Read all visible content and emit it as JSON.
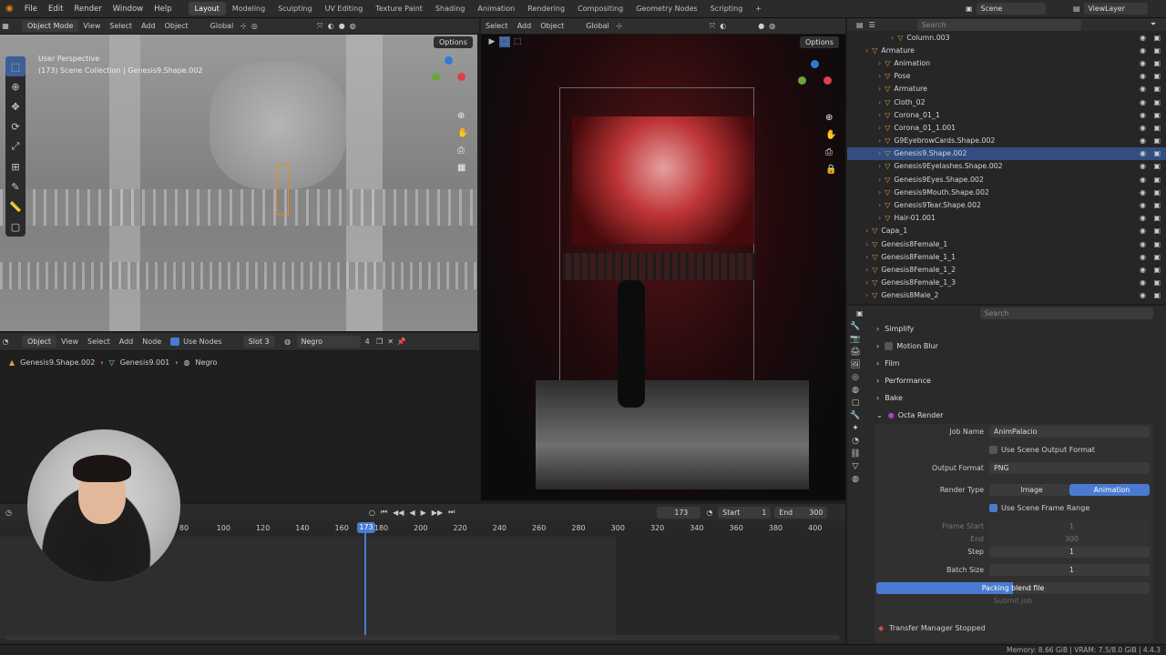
{
  "menu": [
    "File",
    "Edit",
    "Render",
    "Window",
    "Help"
  ],
  "workspaces": [
    "Layout",
    "Modeling",
    "Sculpting",
    "UV Editing",
    "Texture Paint",
    "Shading",
    "Animation",
    "Rendering",
    "Compositing",
    "Geometry Nodes",
    "Scripting"
  ],
  "active_workspace": "Layout",
  "scene": "Scene",
  "view_layer": "ViewLayer",
  "left_viewport": {
    "mode": "Object Mode",
    "menus": [
      "View",
      "Select",
      "Add",
      "Object"
    ],
    "transform": "Global",
    "options": "Options",
    "info_line1": "User Perspective",
    "info_line2": "(173) Scene Collection | Genesis9.Shape.002"
  },
  "right_viewport": {
    "menus": [
      "Select",
      "Add",
      "Object"
    ],
    "transform": "Global",
    "options": "Options"
  },
  "node_editor": {
    "type": "Object",
    "menus": [
      "View",
      "Select",
      "Add",
      "Node"
    ],
    "use_nodes": "Use Nodes",
    "slot": "Slot 3",
    "material": "Negro",
    "users": "4",
    "breadcrumb": [
      "Genesis9.Shape.002",
      "Genesis9.001",
      "Negro"
    ]
  },
  "outliner": {
    "search_placeholder": "Search",
    "rows": [
      {
        "label": "Column.003",
        "indent": 3,
        "sel": false
      },
      {
        "label": "Armature",
        "indent": 1,
        "sel": false
      },
      {
        "label": "Animation",
        "indent": 2,
        "sel": false
      },
      {
        "label": "Pose",
        "indent": 2,
        "sel": false
      },
      {
        "label": "Armature",
        "indent": 2,
        "sel": false
      },
      {
        "label": "Cloth_02",
        "indent": 2,
        "sel": false
      },
      {
        "label": "Corona_01_1",
        "indent": 2,
        "sel": false
      },
      {
        "label": "Corona_01_1.001",
        "indent": 2,
        "sel": false
      },
      {
        "label": "G9EyebrowCards.Shape.002",
        "indent": 2,
        "sel": false
      },
      {
        "label": "Genesis9.Shape.002",
        "indent": 2,
        "sel": true
      },
      {
        "label": "Genesis9Eyelashes.Shape.002",
        "indent": 2,
        "sel": false
      },
      {
        "label": "Genesis9Eyes.Shape.002",
        "indent": 2,
        "sel": false
      },
      {
        "label": "Genesis9Mouth.Shape.002",
        "indent": 2,
        "sel": false
      },
      {
        "label": "Genesis9Tear.Shape.002",
        "indent": 2,
        "sel": false
      },
      {
        "label": "Hair-01.001",
        "indent": 2,
        "sel": false
      },
      {
        "label": "Capa_1",
        "indent": 1,
        "sel": false
      },
      {
        "label": "Genesis8Female_1",
        "indent": 1,
        "sel": false
      },
      {
        "label": "Genesis8Female_1_1",
        "indent": 1,
        "sel": false
      },
      {
        "label": "Genesis8Female_1_2",
        "indent": 1,
        "sel": false
      },
      {
        "label": "Genesis8Female_1_3",
        "indent": 1,
        "sel": false
      },
      {
        "label": "Genesis8Male_2",
        "indent": 1,
        "sel": false
      }
    ]
  },
  "properties": {
    "search_placeholder": "Search",
    "sections": [
      "Simplify",
      "Motion Blur",
      "Film",
      "Performance",
      "Bake"
    ],
    "octa": "Octa Render",
    "job_name_label": "Job Name",
    "job_name": "AnimPalacio",
    "use_scene_output": "Use Scene Output Format",
    "output_format_label": "Output Format",
    "output_format": "PNG",
    "render_type_label": "Render Type",
    "render_type_image": "Image",
    "render_type_anim": "Animation",
    "use_scene_frame_range": "Use Scene Frame Range",
    "frame_start_label": "Frame Start",
    "frame_start": "1",
    "end_label": "End",
    "end": "300",
    "step_label": "Step",
    "step": "1",
    "batch_label": "Batch Size",
    "batch": "1",
    "packing": "Packing blend file",
    "packing_progress": 0.5,
    "submit": "Submit Job",
    "transfer": "Transfer Manager Stopped"
  },
  "timeline": {
    "current_frame": "173",
    "start_label": "Start",
    "start": "1",
    "end_label": "End",
    "end": "300",
    "ticks": [
      "80",
      "100",
      "120",
      "140",
      "160",
      "180",
      "200",
      "220",
      "240",
      "260",
      "280",
      "300",
      "320",
      "340",
      "360",
      "380",
      "400"
    ],
    "playhead_label": "173"
  },
  "status": "Memory: 8.66 GiB | VRAM: 7.5/8.0 GiB | 4.4.3"
}
